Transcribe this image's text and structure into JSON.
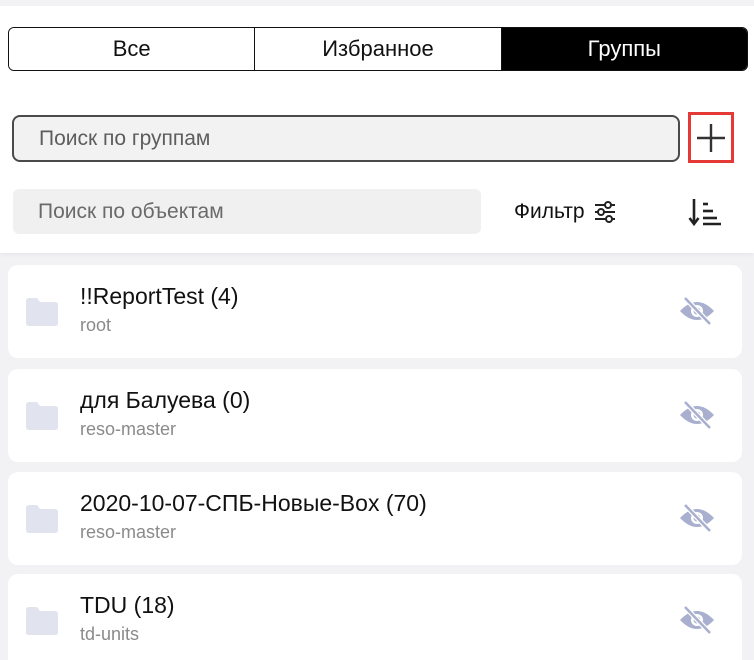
{
  "tabs": [
    {
      "label": "Все",
      "active": false
    },
    {
      "label": "Избранное",
      "active": false
    },
    {
      "label": "Группы",
      "active": true
    }
  ],
  "group_search": {
    "placeholder": "Поиск по группам",
    "value": ""
  },
  "add_button": {
    "icon": "plus-icon",
    "highlight_color": "#e53935"
  },
  "object_search": {
    "placeholder": "Поиск по объектам",
    "value": ""
  },
  "filter": {
    "label": "Фильтр",
    "icon": "sliders-icon"
  },
  "sort": {
    "icon": "sort-descending-icon"
  },
  "groups": [
    {
      "title": "!!ReportTest (4)",
      "subtitle": "root"
    },
    {
      "title": "для Балуева (0)",
      "subtitle": "reso-master"
    },
    {
      "title": "2020-10-07-СПБ-Новые-Box (70)",
      "subtitle": "reso-master"
    },
    {
      "title": "TDU (18)",
      "subtitle": "td-units"
    }
  ],
  "colors": {
    "folder": "#e1e4ef",
    "eye_off": "#a9b0cf",
    "active_tab": "#000000"
  }
}
